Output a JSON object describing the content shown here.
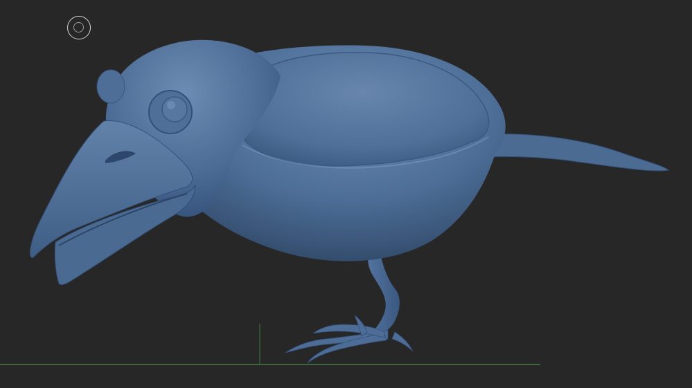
{
  "viewport": {
    "background": "#272727",
    "model_color": "#4a6a92",
    "model_shadow_color": "#2a3f5c",
    "model_highlight_color": "#6f90b8",
    "ground_line_color": "#4f8a4f",
    "axis_line_color": "#3f7a3f"
  },
  "cursor": {
    "icon": "brush-cursor-icon"
  },
  "model": {
    "icon": "crow-sculpt-icon"
  }
}
